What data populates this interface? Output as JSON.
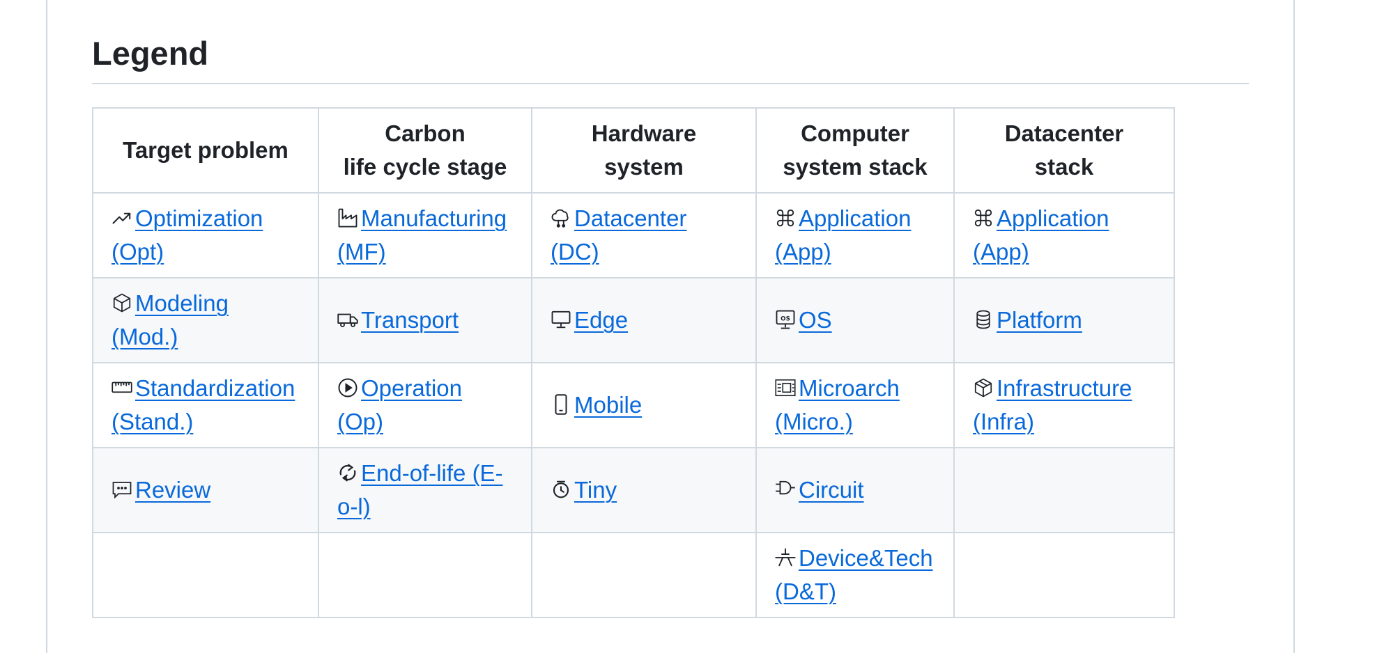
{
  "section": {
    "title": "Legend"
  },
  "headers": {
    "target": "Target problem",
    "carbon_line1": "Carbon",
    "carbon_line2": "life cycle stage",
    "hardware": "Hardware system",
    "computer_line1": "Computer",
    "computer_line2": "system stack",
    "datacenter": "Datacenter stack"
  },
  "target": {
    "opt": "Optimization (Opt)",
    "mod": "Modeling (Mod.)",
    "stand": "Standardization (Stand.)",
    "review": "Review"
  },
  "carbon": {
    "mf": "Manufacturing (MF)",
    "transport": "Transport",
    "op": "Operation (Op)",
    "eol": "End-of-life (E-o-l)"
  },
  "hardware": {
    "dc": "Datacenter (DC)",
    "edge": "Edge",
    "mobile": "Mobile",
    "tiny": "Tiny"
  },
  "computer": {
    "app": "Application (App)",
    "os": "OS",
    "micro": "Microarch (Micro.)",
    "circuit": "Circuit",
    "dt": "Device&Tech (D&T)"
  },
  "datacenter": {
    "app": "Application (App)",
    "platform": "Platform",
    "infra": "Infrastructure (Infra)"
  },
  "icons": {
    "opt": "trending-up-icon",
    "mod": "cube-icon",
    "stand": "ruler-icon",
    "review": "comment-icon",
    "mf": "factory-icon",
    "transport": "truck-icon",
    "op": "play-circle-icon",
    "eol": "recycle-icon",
    "dc": "cloud-server-icon",
    "edge": "monitor-icon",
    "mobile": "phone-icon",
    "tiny": "watch-icon",
    "app": "command-icon",
    "os": "os-monitor-icon",
    "micro": "chip-icon",
    "circuit": "logic-gate-icon",
    "dt": "transistor-icon",
    "platform": "database-icon",
    "infra": "boxes-icon"
  },
  "colors": {
    "link": "#0969da",
    "border": "#d1d9e0",
    "alt_row": "#f6f8fa",
    "text": "#1f2328"
  }
}
